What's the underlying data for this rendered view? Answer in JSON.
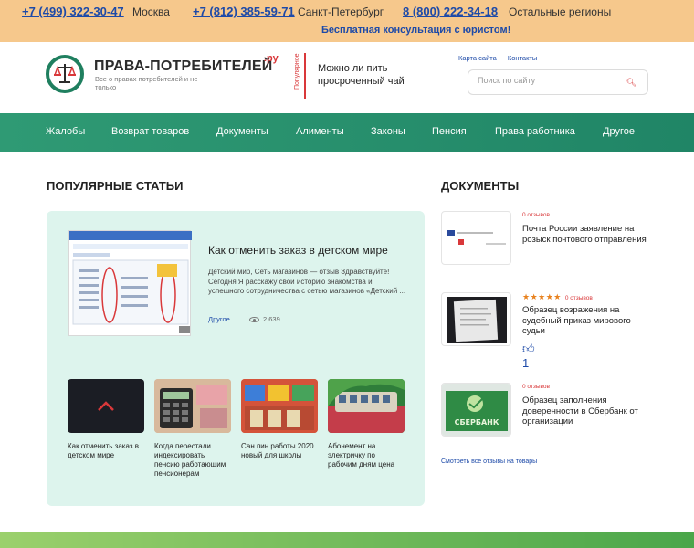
{
  "topbar": {
    "phones": [
      {
        "number": "+7 (499) 322-30-47",
        "region": "Москва"
      },
      {
        "number": "+7 (812) 385-59-71",
        "region": "Санкт-Петербург"
      },
      {
        "number": "8 (800) 222-34-18",
        "region": "Остальные регионы"
      }
    ],
    "consult": "Бесплатная консультация с юристом!"
  },
  "header": {
    "logo_title": "ПРАВА-ПОТРЕБИТЕЛЕЙ",
    "logo_suffix": ".ру",
    "logo_subtitle": "Все о правах потребителей и не только",
    "popular_label": "Популярное",
    "popular_text": "Можно ли пить просроченный чай",
    "links": {
      "sitemap": "Карта сайта",
      "contacts": "Контакты"
    },
    "search_placeholder": "Поиск по сайту"
  },
  "nav": [
    "Жалобы",
    "Возврат товаров",
    "Документы",
    "Алименты",
    "Законы",
    "Пенсия",
    "Права работника",
    "Другое"
  ],
  "popular": {
    "title": "ПОПУЛЯРНЫЕ СТАТЬИ",
    "featured": {
      "title": "Как отменить заказ в детском мире",
      "description": "Детский мир, Сеть магазинов — отзыв Здравствуйте! Сегодня Я расскажу свои историю знакомства и успешного сотрудничества с сетью магазинов «Детский ...",
      "category": "Другое",
      "views": "2 639"
    },
    "cards": [
      {
        "title": "Как отменить заказ в детском мире"
      },
      {
        "title": "Когда перестали индексировать пенсию работающим пенсионерам"
      },
      {
        "title": "Сан пин работы 2020 новый для школы"
      },
      {
        "title": "Абонемент на электричку по рабочим дням цена"
      }
    ]
  },
  "documents": {
    "title": "ДОКУМЕНТЫ",
    "items": [
      {
        "reviews": "0 отзывов",
        "title": "Почта России заявление на розыск почтового отправления"
      },
      {
        "stars": "★★★★★",
        "reviews": "0 отзывов",
        "title": "Образец возражения на судебный приказ мирового судьи",
        "likes": "1"
      },
      {
        "reviews": "0 отзывов",
        "title": "Образец заполнения доверенности в Сбербанк от организации",
        "image_text": "СБЕРБАНК"
      }
    ],
    "all_reviews": "Смотреть все отзывы на товары"
  },
  "colors": {
    "accent_green": "#208566",
    "brand_red": "#d9383a",
    "link_blue": "#1d4aa8",
    "topbar": "#f6c88c"
  }
}
